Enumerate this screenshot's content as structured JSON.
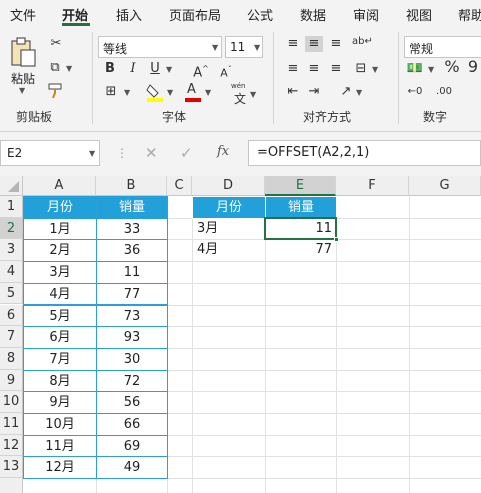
{
  "ribbon": {
    "tabs": [
      "文件",
      "开始",
      "插入",
      "页面布局",
      "公式",
      "数据",
      "审阅",
      "视图",
      "帮助"
    ],
    "clipboard": {
      "paste_label": "粘贴",
      "group_label": "剪贴板"
    },
    "font": {
      "name": "等线",
      "size": "11",
      "group_label": "字体",
      "wen_label": "wén",
      "wen_char": "文"
    },
    "alignment": {
      "group_label": "对齐方式"
    },
    "number": {
      "format": "常规",
      "group_label": "数字"
    }
  },
  "formula_bar": {
    "name_box": "E2",
    "cancel": "✕",
    "enter": "✓",
    "fx": "fx",
    "formula": "=OFFSET(A2,2,1)"
  },
  "columns": [
    "A",
    "B",
    "C",
    "D",
    "E",
    "F",
    "G"
  ],
  "rows": [
    "1",
    "2",
    "3",
    "4",
    "5",
    "6",
    "7",
    "8",
    "9",
    "10",
    "11",
    "12",
    "13"
  ],
  "table": {
    "headers": [
      "月份",
      "销量"
    ],
    "months": [
      "1月",
      "2月",
      "3月",
      "4月",
      "5月",
      "6月",
      "7月",
      "8月",
      "9月",
      "10月",
      "11月",
      "12月"
    ],
    "sales": [
      "33",
      "36",
      "11",
      "77",
      "73",
      "93",
      "30",
      "72",
      "56",
      "66",
      "69",
      "49"
    ]
  },
  "result": {
    "headers": [
      "月份",
      "销量"
    ],
    "rows": [
      [
        "3月",
        "11"
      ],
      [
        "4月",
        "77"
      ]
    ]
  },
  "accent": "#217346",
  "header_fill": "#21a0d9"
}
